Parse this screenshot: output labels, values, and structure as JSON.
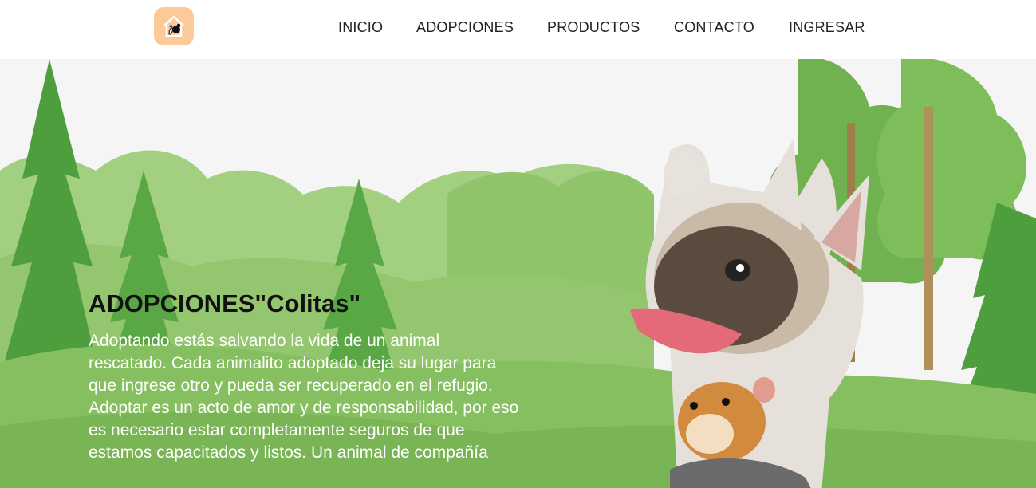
{
  "nav": {
    "logo_icon": "house-pet-logo-icon",
    "links": [
      "INICIO",
      "ADOPCIONES",
      "PRODUCTOS",
      "CONTACTO",
      "INGRESAR"
    ]
  },
  "hero": {
    "title": "ADOPCIONES\"Colitas\"",
    "text": "Adoptando estás salvando la vida de un animal rescatado. Cada animalito adoptado deja su lugar para que ingrese otro y pueda ser recuperado en el refugio. Adoptar es un acto de amor y de responsabilidad, por eso es necesario estar completamente seguros de que estamos capacitados y listos. Un animal de compañía",
    "colors": {
      "bg_light": "#f4f5f4",
      "tree_dark": "#4f9e3e",
      "tree_mid": "#74b457",
      "grass": "#8cc26a",
      "logo_bg": "#fcc998"
    }
  }
}
